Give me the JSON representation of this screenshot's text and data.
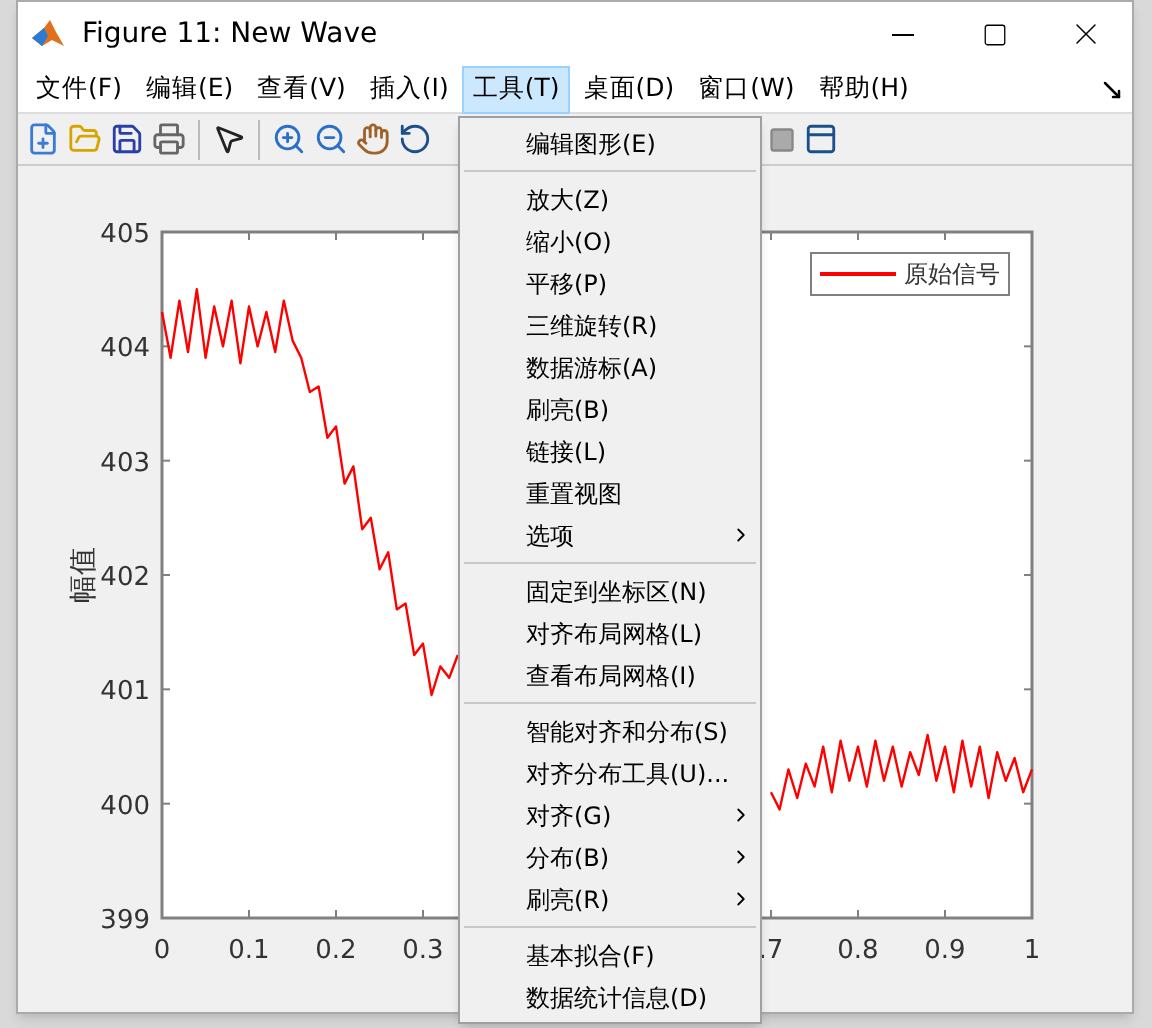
{
  "window": {
    "title": "Figure 11: New Wave"
  },
  "menu_bar": [
    {
      "label": "文件(F)",
      "selected": false
    },
    {
      "label": "编辑(E)",
      "selected": false
    },
    {
      "label": "查看(V)",
      "selected": false
    },
    {
      "label": "插入(I)",
      "selected": false
    },
    {
      "label": "工具(T)",
      "selected": true
    },
    {
      "label": "桌面(D)",
      "selected": false
    },
    {
      "label": "窗口(W)",
      "selected": false
    },
    {
      "label": "帮助(H)",
      "selected": false
    }
  ],
  "tools_menu": {
    "groups": [
      [
        {
          "label": "编辑图形(E)",
          "submenu": false
        }
      ],
      [
        {
          "label": "放大(Z)",
          "submenu": false
        },
        {
          "label": "缩小(O)",
          "submenu": false
        },
        {
          "label": "平移(P)",
          "submenu": false
        },
        {
          "label": "三维旋转(R)",
          "submenu": false
        },
        {
          "label": "数据游标(A)",
          "submenu": false
        },
        {
          "label": "刷亮(B)",
          "submenu": false
        },
        {
          "label": "链接(L)",
          "submenu": false
        },
        {
          "label": "重置视图",
          "submenu": false
        },
        {
          "label": "选项",
          "submenu": true
        }
      ],
      [
        {
          "label": "固定到坐标区(N)",
          "submenu": false
        },
        {
          "label": "对齐布局网格(L)",
          "submenu": false
        },
        {
          "label": "查看布局网格(I)",
          "submenu": false
        }
      ],
      [
        {
          "label": "智能对齐和分布(S)",
          "submenu": false
        },
        {
          "label": "对齐分布工具(U)...",
          "submenu": false
        },
        {
          "label": "对齐(G)",
          "submenu": true
        },
        {
          "label": "分布(B)",
          "submenu": true
        },
        {
          "label": "刷亮(R)",
          "submenu": true
        }
      ],
      [
        {
          "label": "基本拟合(F)",
          "submenu": false
        },
        {
          "label": "数据统计信息(D)",
          "submenu": false
        }
      ]
    ]
  },
  "plot": {
    "chart_data": {
      "type": "line",
      "ylabel": "幅值",
      "xlim": [
        0,
        1
      ],
      "ylim": [
        399,
        405
      ],
      "xticks": [
        0,
        0.1,
        0.2,
        0.3,
        {
          "value": 0.7,
          "label": ".7"
        },
        0.8,
        0.9,
        1
      ],
      "yticks": [
        399,
        400,
        401,
        402,
        403,
        404,
        405
      ],
      "x": [
        0,
        0.01,
        0.02,
        0.03,
        0.04,
        0.05,
        0.06,
        0.07,
        0.08,
        0.09,
        0.1,
        0.11,
        0.12,
        0.13,
        0.14,
        0.15,
        0.16,
        0.17,
        0.18,
        0.19,
        0.2,
        0.21,
        0.22,
        0.23,
        0.24,
        0.25,
        0.26,
        0.27,
        0.28,
        0.29,
        0.3,
        0.31,
        0.32,
        0.33,
        0.34,
        0.35,
        0.69,
        0.7,
        0.71,
        0.72,
        0.73,
        0.74,
        0.75,
        0.76,
        0.77,
        0.78,
        0.79,
        0.8,
        0.81,
        0.82,
        0.83,
        0.84,
        0.85,
        0.86,
        0.87,
        0.88,
        0.89,
        0.9,
        0.91,
        0.92,
        0.93,
        0.94,
        0.95,
        0.96,
        0.97,
        0.98,
        0.99,
        1
      ],
      "series": [
        {
          "name": "原始信号",
          "color": "#ff0000",
          "values": [
            404.3,
            403.9,
            404.4,
            403.95,
            404.5,
            403.9,
            404.35,
            404.0,
            404.4,
            403.85,
            404.35,
            404.0,
            404.3,
            403.95,
            404.4,
            404.05,
            403.9,
            403.6,
            403.65,
            403.2,
            403.3,
            402.8,
            402.95,
            402.4,
            402.5,
            402.05,
            402.2,
            401.7,
            401.75,
            401.3,
            401.4,
            400.95,
            401.2,
            401.1,
            401.3,
            null,
            null,
            400.1,
            399.95,
            400.3,
            400.05,
            400.35,
            400.15,
            400.5,
            400.1,
            400.55,
            400.2,
            400.5,
            400.15,
            400.55,
            400.2,
            400.5,
            400.15,
            400.45,
            400.25,
            400.6,
            400.2,
            400.5,
            400.1,
            400.55,
            400.15,
            400.5,
            400.05,
            400.45,
            400.2,
            400.4,
            400.1,
            400.3
          ]
        }
      ]
    }
  }
}
